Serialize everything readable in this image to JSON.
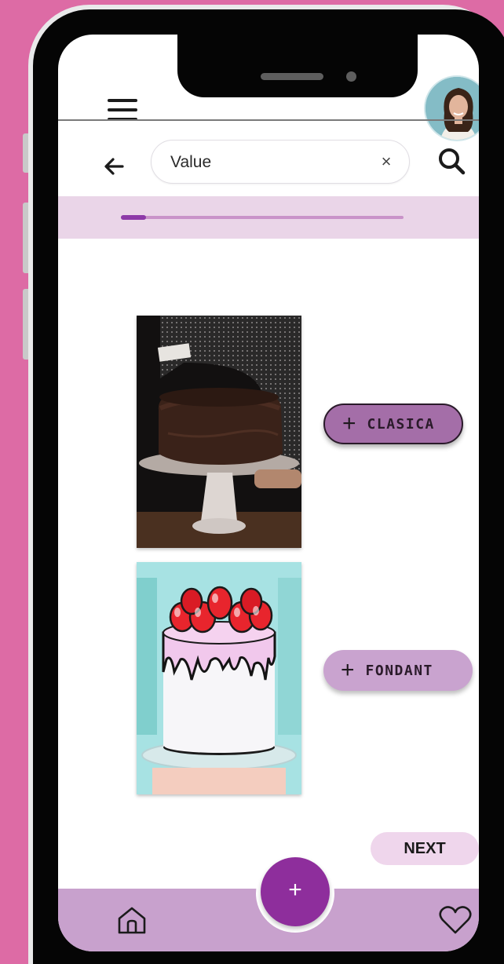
{
  "search": {
    "value": "Value",
    "clear_symbol": "×"
  },
  "progress": {
    "fraction": 0.09
  },
  "categories": [
    {
      "label": "CLASICA",
      "icon": "plus-icon",
      "image": "chocolate-cake"
    },
    {
      "label": "FONDANT",
      "icon": "plus-icon",
      "image": "strawberry-drip-cake"
    }
  ],
  "plus_symbol": "+",
  "next_label": "NEXT",
  "fab_symbol": "+",
  "colors": {
    "background": "#dd6ba5",
    "accent": "#8e2e9c",
    "progress_band": "#ead5e8",
    "bottom_bar": "#c8a1cd",
    "clasica_button": "#a46ea8",
    "fondant_button": "#c9a3cf"
  }
}
